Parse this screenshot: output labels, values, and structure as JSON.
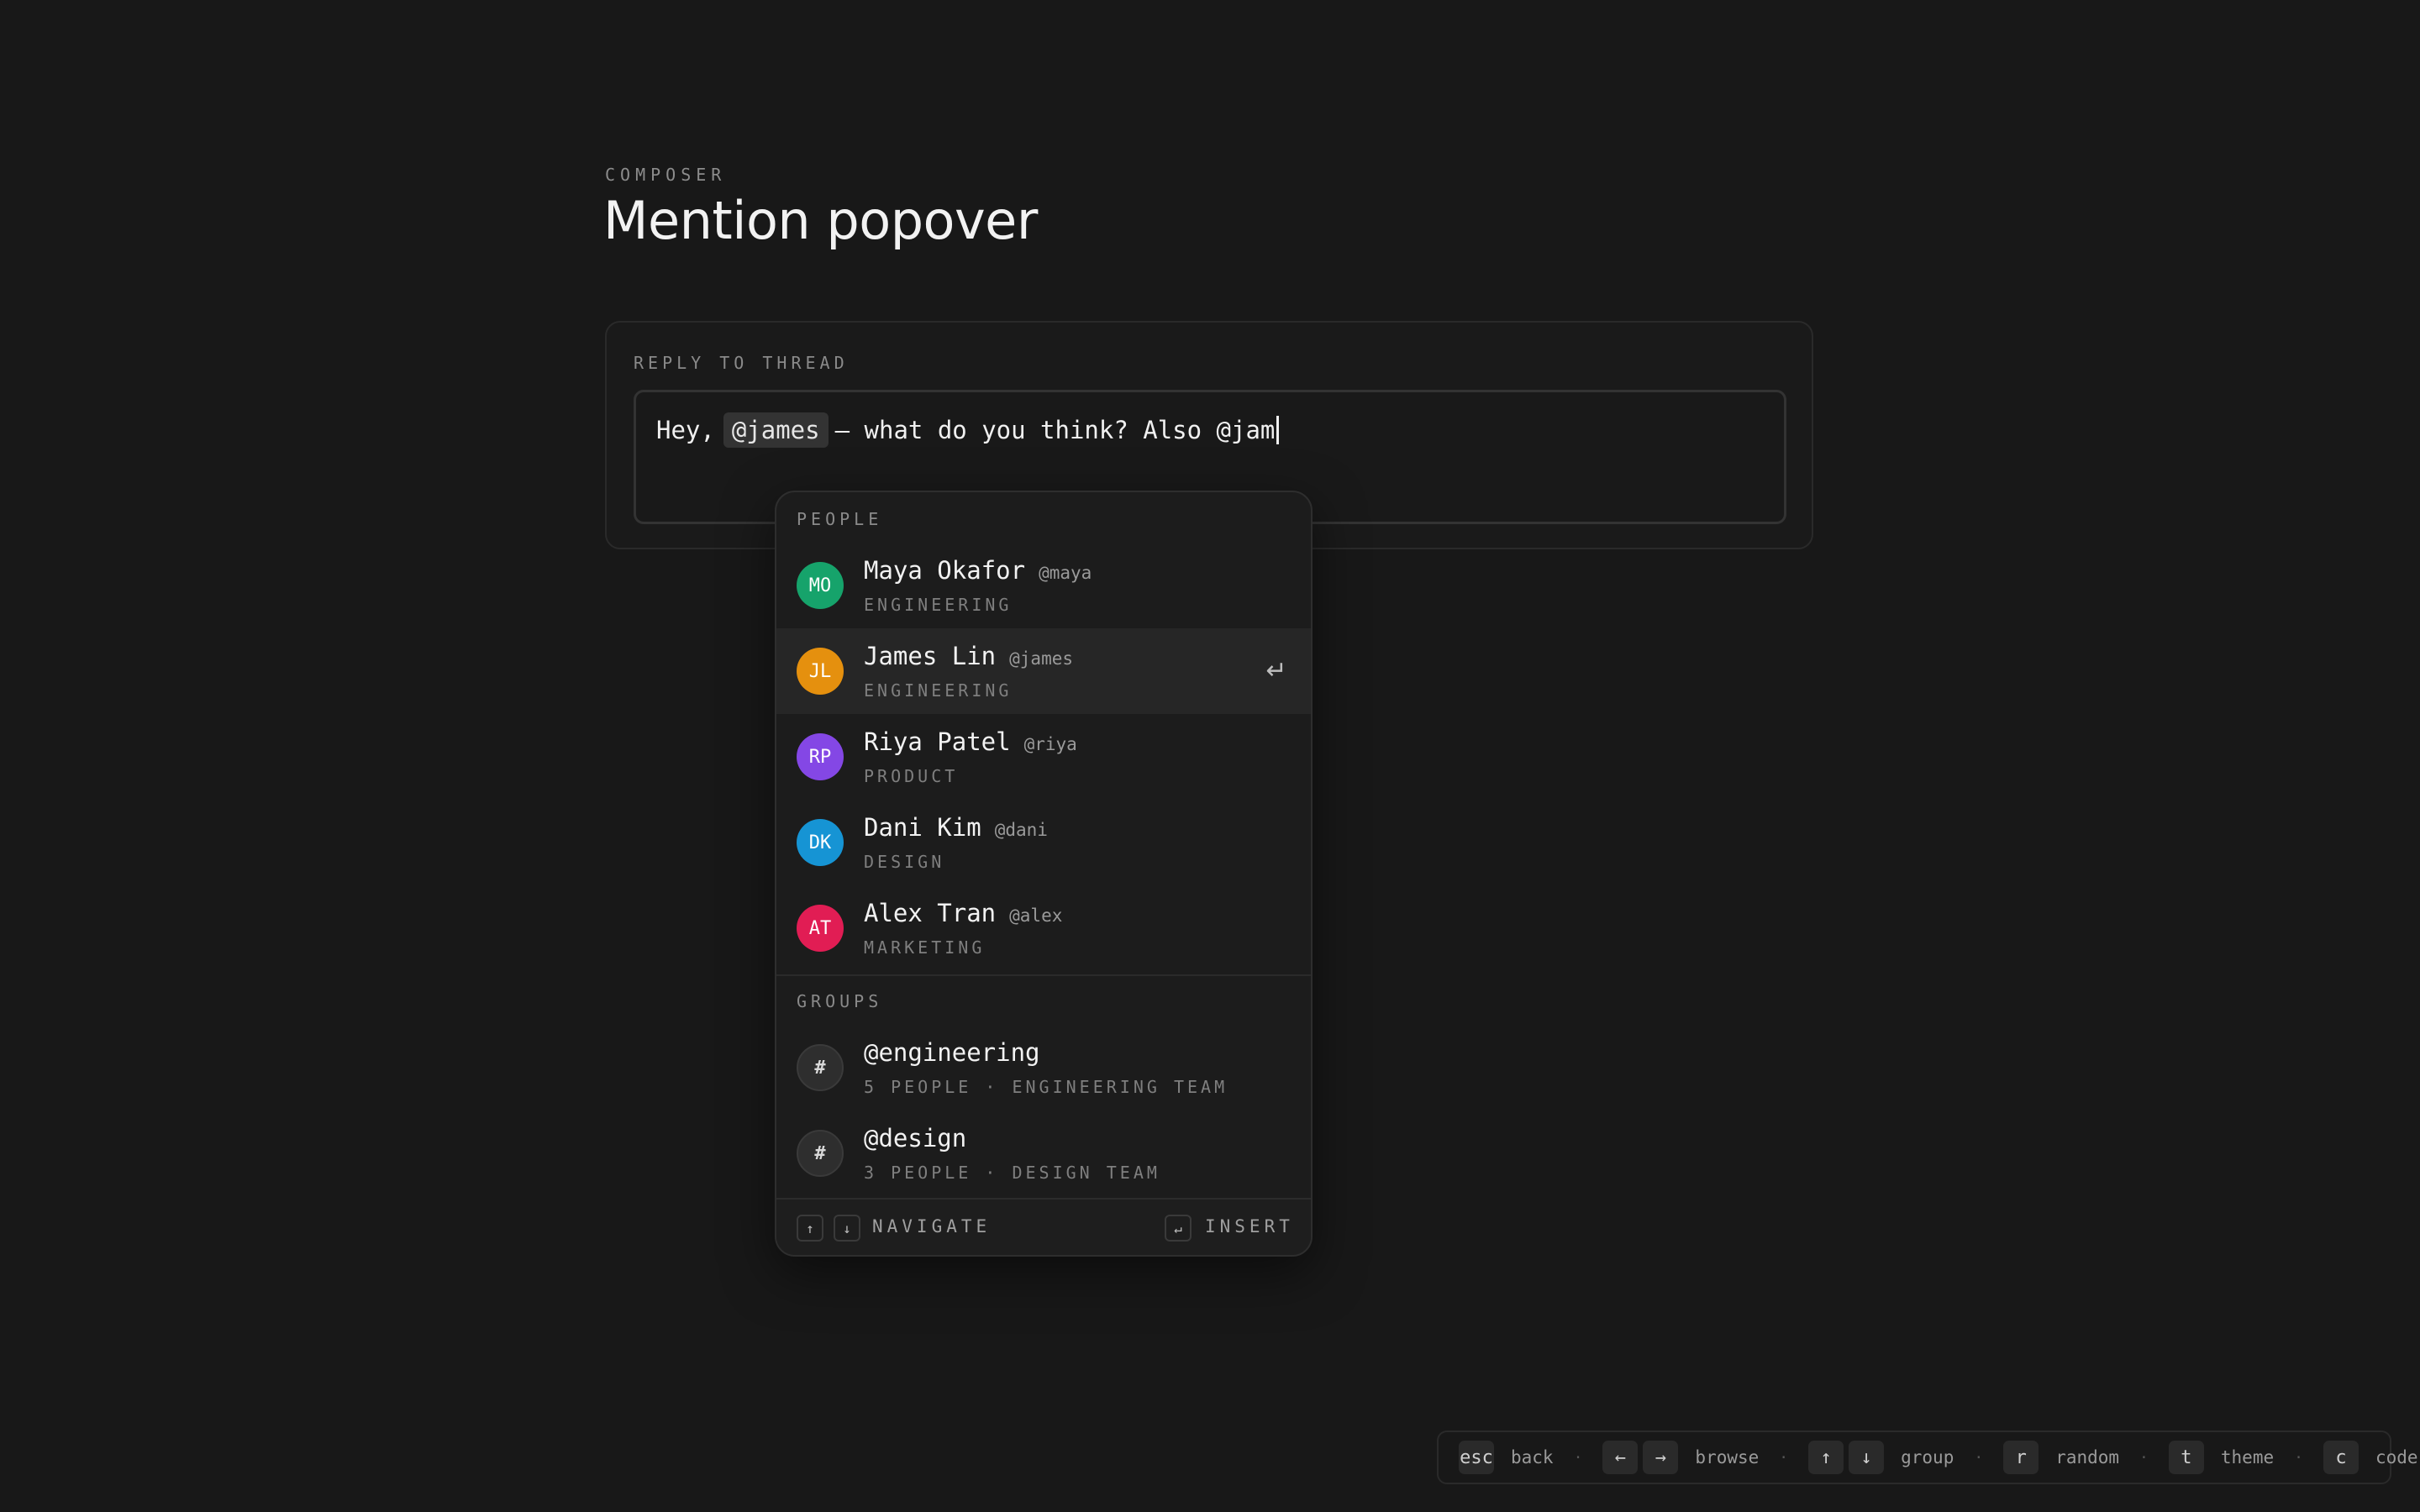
{
  "page": {
    "eyebrow": "COMPOSER",
    "title": "Mention popover"
  },
  "composer": {
    "label": "REPLY TO THREAD",
    "text_before": "Hey,",
    "mention_chip": "@james",
    "text_after": "— what do you think? Also @jam"
  },
  "popover": {
    "people_label": "PEOPLE",
    "people": [
      {
        "initials": "MO",
        "name": "Maya Okafor",
        "handle": "@maya",
        "team": "ENGINEERING",
        "color": "#16a36b"
      },
      {
        "initials": "JL",
        "name": "James Lin",
        "handle": "@james",
        "team": "ENGINEERING",
        "color": "#e5900e"
      },
      {
        "initials": "RP",
        "name": "Riya Patel",
        "handle": "@riya",
        "team": "PRODUCT",
        "color": "#8447e5"
      },
      {
        "initials": "DK",
        "name": "Dani Kim",
        "handle": "@dani",
        "team": "DESIGN",
        "color": "#1694d4"
      },
      {
        "initials": "AT",
        "name": "Alex Tran",
        "handle": "@alex",
        "team": "MARKETING",
        "color": "#e11d54"
      }
    ],
    "active_index": 1,
    "groups_label": "GROUPS",
    "groups": [
      {
        "icon": "#",
        "name": "@engineering",
        "meta": "5 PEOPLE · ENGINEERING TEAM"
      },
      {
        "icon": "#",
        "name": "@design",
        "meta": "3 PEOPLE · DESIGN TEAM"
      }
    ],
    "footer": {
      "up_key": "↑",
      "down_key": "↓",
      "navigate": "NAVIGATE",
      "enter_key": "↵",
      "insert": "INSERT"
    },
    "enter_glyph": "↵"
  },
  "hints": [
    {
      "keys": [
        "esc"
      ],
      "label": "back"
    },
    {
      "keys": [
        "←",
        "→"
      ],
      "label": "browse"
    },
    {
      "keys": [
        "↑",
        "↓"
      ],
      "label": "group"
    },
    {
      "keys": [
        "r"
      ],
      "label": "random"
    },
    {
      "keys": [
        "t"
      ],
      "label": "theme"
    },
    {
      "keys": [
        "c"
      ],
      "label": "code"
    }
  ],
  "hint_separator": "·"
}
